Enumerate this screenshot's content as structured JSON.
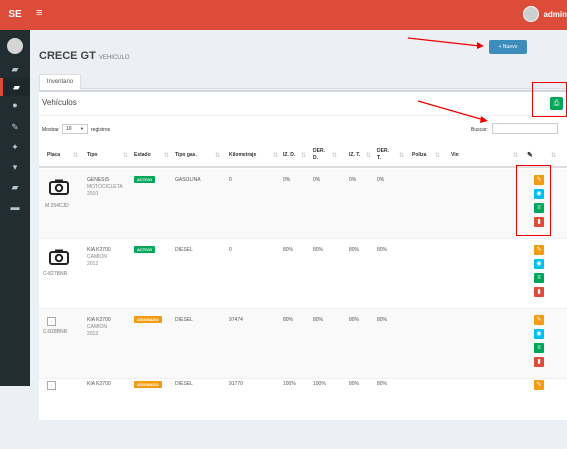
{
  "app": {
    "logo": "SE",
    "menu_glyph": "≡",
    "user": "admin"
  },
  "sidebar": {
    "items": [
      {
        "icon": "car-icon",
        "glyph": "▰"
      },
      {
        "icon": "car-icon-active",
        "glyph": "▰"
      },
      {
        "icon": "user-icon",
        "glyph": "●"
      },
      {
        "icon": "edit-icon",
        "glyph": "✎"
      },
      {
        "icon": "wrench-icon",
        "glyph": "✦"
      },
      {
        "icon": "drop-icon",
        "glyph": "▾"
      },
      {
        "icon": "bus-icon",
        "glyph": "▰"
      },
      {
        "icon": "money-icon",
        "glyph": "▬"
      }
    ]
  },
  "header": {
    "title": "CRECE GT",
    "subtitle": "VEHICULO",
    "new_button": "+ Nuevo"
  },
  "tabs": [
    {
      "label": "Inventario"
    }
  ],
  "panel": {
    "title": "Vehículos",
    "export_glyph": "⎙"
  },
  "table_controls": {
    "show_label": "Mostrar",
    "show_value": "10",
    "show_suffix": "registros",
    "search_label": "Buscar:"
  },
  "columns": [
    "Placa",
    "Tipo",
    "Estado",
    "Tipo gas.",
    "Kilometraje",
    "IZ. D.",
    "DER. D.",
    "IZ. T.",
    "DER. T.",
    "Poliza",
    "Vin"
  ],
  "rows": [
    {
      "placa": "M 254CJD",
      "tipo": "GENESIS",
      "tipo2": "MOTOCICLETA",
      "tipo3": "2010",
      "estado": "ACTIVO",
      "estado_color": "#00a65a",
      "gas": "GASOLINA",
      "km": "0",
      "izd": "0%",
      "derd": "0%",
      "izt": "0%",
      "dert": "0%",
      "img": "camera"
    },
    {
      "placa": "C-827BNR",
      "tipo": "KIA K2700",
      "tipo2": "CAMION",
      "tipo3": "2013",
      "estado": "ACTIVO",
      "estado_color": "#00a65a",
      "gas": "DIESEL",
      "km": "0",
      "izd": "80%",
      "derd": "80%",
      "izt": "80%",
      "dert": "80%",
      "img": "camera"
    },
    {
      "placa": "C-828BNR",
      "tipo": "KIA K2700",
      "tipo2": "CAMION",
      "tipo3": "2013",
      "estado": "ASIGNADO",
      "estado_color": "#f39c12",
      "gas": "DIESEL",
      "km": "97474",
      "izd": "80%",
      "derd": "80%",
      "izt": "80%",
      "dert": "80%",
      "img": "broken"
    },
    {
      "placa": "",
      "tipo": "KIA K2700",
      "tipo2": "",
      "tipo3": "",
      "estado": "ASIGNADO",
      "estado_color": "#f39c12",
      "gas": "DIESEL",
      "km": "91770",
      "izd": "100%",
      "derd": "100%",
      "izt": "80%",
      "dert": "80%",
      "img": "broken"
    }
  ],
  "colors": {
    "topbar": "#dd4b39",
    "sidebar": "#222d32",
    "primary": "#3c8dbc",
    "success": "#00a65a",
    "warning": "#f39c12",
    "info": "#00c0ef",
    "danger": "#dd4b39"
  }
}
